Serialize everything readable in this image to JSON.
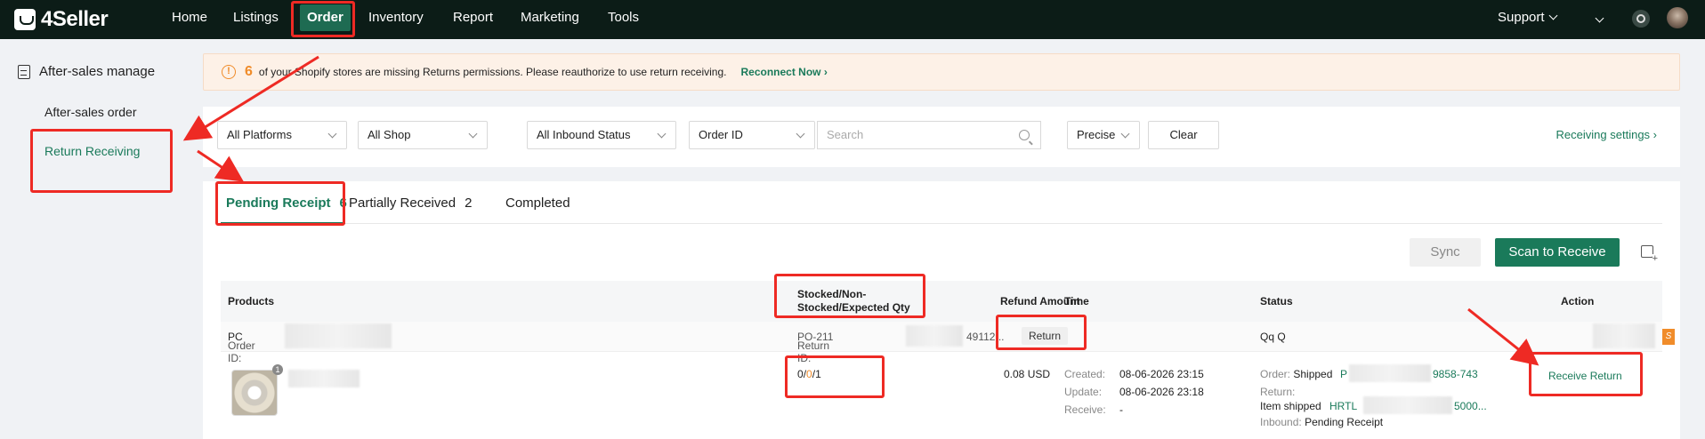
{
  "app": {
    "name": "4Seller"
  },
  "nav": {
    "items": [
      {
        "label": "Home"
      },
      {
        "label": "Listings"
      },
      {
        "label": "Order"
      },
      {
        "label": "Inventory"
      },
      {
        "label": "Report"
      },
      {
        "label": "Marketing"
      },
      {
        "label": "Tools"
      }
    ],
    "active": "Order",
    "support": "Support"
  },
  "sidebar": {
    "section": "After-sales manage",
    "items": [
      {
        "label": "After-sales order"
      },
      {
        "label": "Return Receiving"
      }
    ],
    "active": "Return Receiving"
  },
  "banner": {
    "count": "6",
    "message": "of your Shopify stores are missing Returns permissions. Please reauthorize to use return receiving.",
    "link": "Reconnect Now"
  },
  "filters": {
    "platform": "All Platforms",
    "shop": "All Shop",
    "inbound_status": "All Inbound Status",
    "id_type": "Order ID",
    "search_placeholder": "Search",
    "match": "Precise",
    "clear": "Clear",
    "settings_link": "Receiving settings"
  },
  "tabs": [
    {
      "label": "Pending Receipt",
      "count": "6"
    },
    {
      "label": "Partially Received",
      "count": "2"
    },
    {
      "label": "Completed",
      "count": ""
    }
  ],
  "toolbar": {
    "sync": "Sync",
    "scan": "Scan to Receive"
  },
  "table": {
    "headers": {
      "products": "Products",
      "qty_line1": "Stocked/Non-",
      "qty_line2": "Stocked/Expected Qty",
      "refund": "Refund Amount",
      "time": "Time",
      "status": "Status",
      "action": "Action"
    },
    "group": {
      "order_id_label": "Order ID:",
      "order_id_value": "PC",
      "return_id_label": "Return ID:",
      "return_id_value": "PO-211",
      "return_id_tail": "49112...",
      "type_tag": "Return",
      "customer": "Qq Q"
    },
    "row": {
      "qty_badge": "1",
      "stocked": "0",
      "non_stocked": "0",
      "expected": "1",
      "refund": "0.08 USD",
      "created_label": "Created:",
      "created": "08-06-2026 23:15",
      "update_label": "Update:",
      "update": "08-06-2026 23:18",
      "receive_label": "Receive:",
      "receive": "-",
      "order_label": "Order:",
      "order_status": "Shipped",
      "order_no_head": "P",
      "order_no_tail": "9858-743",
      "return_label": "Return:",
      "item_shipped_label": "Item shipped",
      "tracking_head": "HRTL",
      "tracking_tail": "5000...",
      "inbound_label": "Inbound:",
      "inbound_status": "Pending Receipt",
      "action": "Receive Return"
    }
  },
  "colors": {
    "accent": "#1a7a5a",
    "warning": "#f08c2a",
    "annotation": "#ee2a24"
  }
}
